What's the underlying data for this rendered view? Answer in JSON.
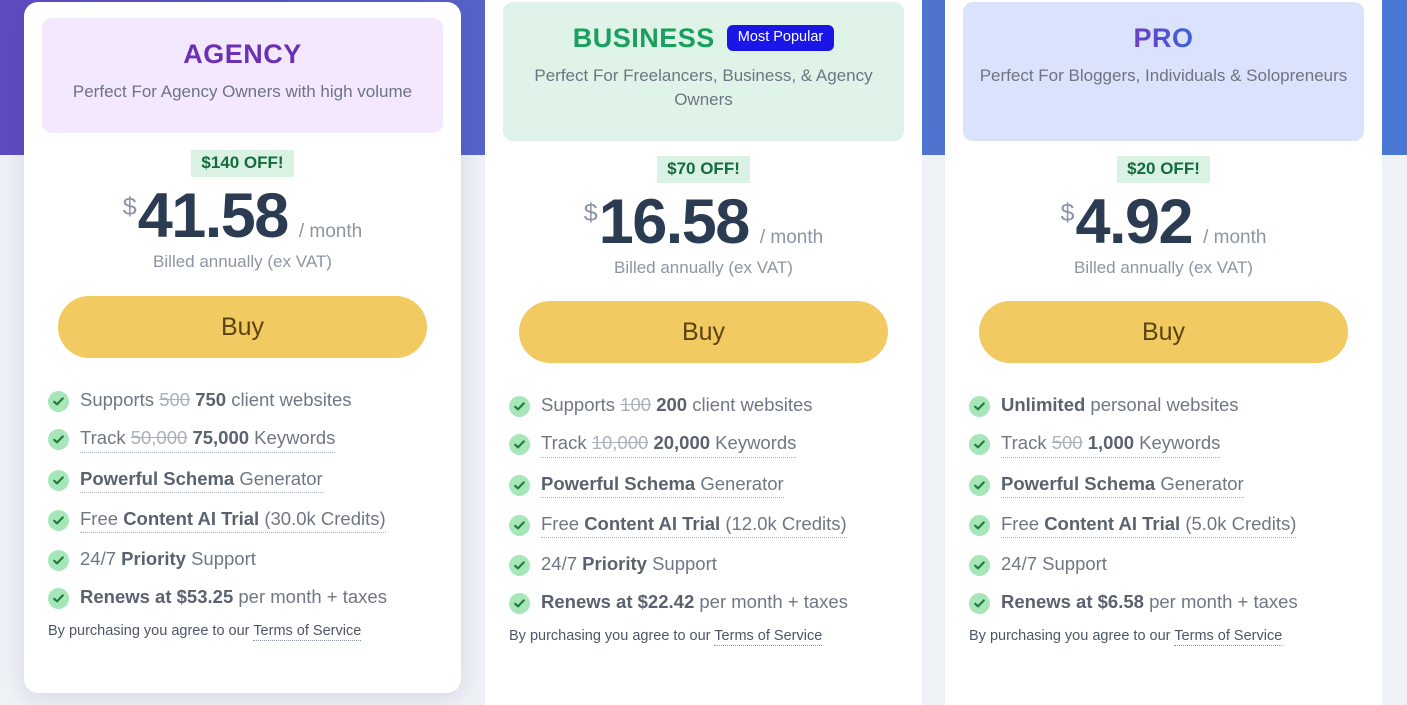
{
  "background": {
    "top_band_color_left": "#5e4cc0",
    "top_band_color_right": "#4a7ad4",
    "lower_band_color": "#eef1f6"
  },
  "common": {
    "currency_symbol": "$",
    "period_label": "/ month",
    "billed_note": "Billed annually (ex VAT)",
    "buy_label": "Buy",
    "terms_prefix": "By purchasing you agree to our",
    "terms_link_label": "Terms of Service",
    "check_icon": "check-circle-icon"
  },
  "plans": [
    {
      "id": "agency",
      "title": "AGENCY",
      "title_color": "#6b31b5",
      "header_bg": "#f3e8fd",
      "subtitle": "Perfect For Agency Owners with high volume",
      "badge": null,
      "discount": "$140 OFF!",
      "price_amount": "41.58",
      "features": [
        {
          "parts": [
            {
              "t": "Supports ",
              "s": "normal"
            },
            {
              "t": "500",
              "s": "strike"
            },
            {
              "t": " ",
              "s": "normal"
            },
            {
              "t": "750",
              "s": "bold"
            },
            {
              "t": " client websites",
              "s": "normal"
            }
          ],
          "hinted": false
        },
        {
          "parts": [
            {
              "t": "Track ",
              "s": "normal"
            },
            {
              "t": "50,000",
              "s": "strike"
            },
            {
              "t": " ",
              "s": "normal"
            },
            {
              "t": "75,000",
              "s": "bold"
            },
            {
              "t": " Keywords",
              "s": "normal"
            }
          ],
          "hinted": true
        },
        {
          "parts": [
            {
              "t": "Powerful Schema",
              "s": "bold"
            },
            {
              "t": " Generator",
              "s": "normal"
            }
          ],
          "hinted": true
        },
        {
          "parts": [
            {
              "t": "Free ",
              "s": "normal"
            },
            {
              "t": "Content AI Trial",
              "s": "bold"
            },
            {
              "t": " (30.0k Credits)",
              "s": "normal"
            }
          ],
          "hinted": true
        },
        {
          "parts": [
            {
              "t": "24/7 ",
              "s": "normal"
            },
            {
              "t": "Priority",
              "s": "bold"
            },
            {
              "t": " Support",
              "s": "normal"
            }
          ],
          "hinted": false
        },
        {
          "parts": [
            {
              "t": "Renews at $53.25",
              "s": "bold"
            },
            {
              "t": " per month + taxes",
              "s": "normal"
            }
          ],
          "hinted": false
        }
      ]
    },
    {
      "id": "business",
      "title": "BUSINESS",
      "title_color": "#18a05c",
      "header_bg": "#dff3e8",
      "subtitle": "Perfect For Freelancers, Business, & Agency Owners",
      "badge": "Most Popular",
      "badge_bg": "#1a16e8",
      "discount": "$70 OFF!",
      "price_amount": "16.58",
      "features": [
        {
          "parts": [
            {
              "t": "Supports ",
              "s": "normal"
            },
            {
              "t": "100",
              "s": "strike"
            },
            {
              "t": " ",
              "s": "normal"
            },
            {
              "t": "200",
              "s": "bold"
            },
            {
              "t": " client websites",
              "s": "normal"
            }
          ],
          "hinted": false
        },
        {
          "parts": [
            {
              "t": "Track ",
              "s": "normal"
            },
            {
              "t": "10,000",
              "s": "strike"
            },
            {
              "t": " ",
              "s": "normal"
            },
            {
              "t": "20,000",
              "s": "bold"
            },
            {
              "t": " Keywords",
              "s": "normal"
            }
          ],
          "hinted": true
        },
        {
          "parts": [
            {
              "t": "Powerful Schema",
              "s": "bold"
            },
            {
              "t": " Generator",
              "s": "normal"
            }
          ],
          "hinted": true
        },
        {
          "parts": [
            {
              "t": "Free ",
              "s": "normal"
            },
            {
              "t": "Content AI Trial",
              "s": "bold"
            },
            {
              "t": " (12.0k Credits)",
              "s": "normal"
            }
          ],
          "hinted": true
        },
        {
          "parts": [
            {
              "t": "24/7 ",
              "s": "normal"
            },
            {
              "t": "Priority",
              "s": "bold"
            },
            {
              "t": " Support",
              "s": "normal"
            }
          ],
          "hinted": false
        },
        {
          "parts": [
            {
              "t": "Renews at $22.42",
              "s": "bold"
            },
            {
              "t": " per month + taxes",
              "s": "normal"
            }
          ],
          "hinted": false
        }
      ]
    },
    {
      "id": "pro",
      "title": "PRO",
      "title_color": "#4f4fd0",
      "header_bg": "#dbe2fb",
      "subtitle": "Perfect For Bloggers, Individuals & Solopreneurs",
      "badge": null,
      "discount": "$20 OFF!",
      "price_amount": "4.92",
      "features": [
        {
          "parts": [
            {
              "t": "Unlimited",
              "s": "bold"
            },
            {
              "t": " personal websites",
              "s": "normal"
            }
          ],
          "hinted": false
        },
        {
          "parts": [
            {
              "t": "Track ",
              "s": "normal"
            },
            {
              "t": "500",
              "s": "strike"
            },
            {
              "t": " ",
              "s": "normal"
            },
            {
              "t": "1,000",
              "s": "bold"
            },
            {
              "t": " Keywords",
              "s": "normal"
            }
          ],
          "hinted": true
        },
        {
          "parts": [
            {
              "t": "Powerful Schema",
              "s": "bold"
            },
            {
              "t": " Generator",
              "s": "normal"
            }
          ],
          "hinted": true
        },
        {
          "parts": [
            {
              "t": "Free ",
              "s": "normal"
            },
            {
              "t": "Content AI Trial",
              "s": "bold"
            },
            {
              "t": " (5.0k Credits)",
              "s": "normal"
            }
          ],
          "hinted": true
        },
        {
          "parts": [
            {
              "t": "24/7 Support",
              "s": "normal"
            }
          ],
          "hinted": false
        },
        {
          "parts": [
            {
              "t": "Renews at $6.58",
              "s": "bold"
            },
            {
              "t": " per month + taxes",
              "s": "normal"
            }
          ],
          "hinted": false
        }
      ]
    }
  ]
}
